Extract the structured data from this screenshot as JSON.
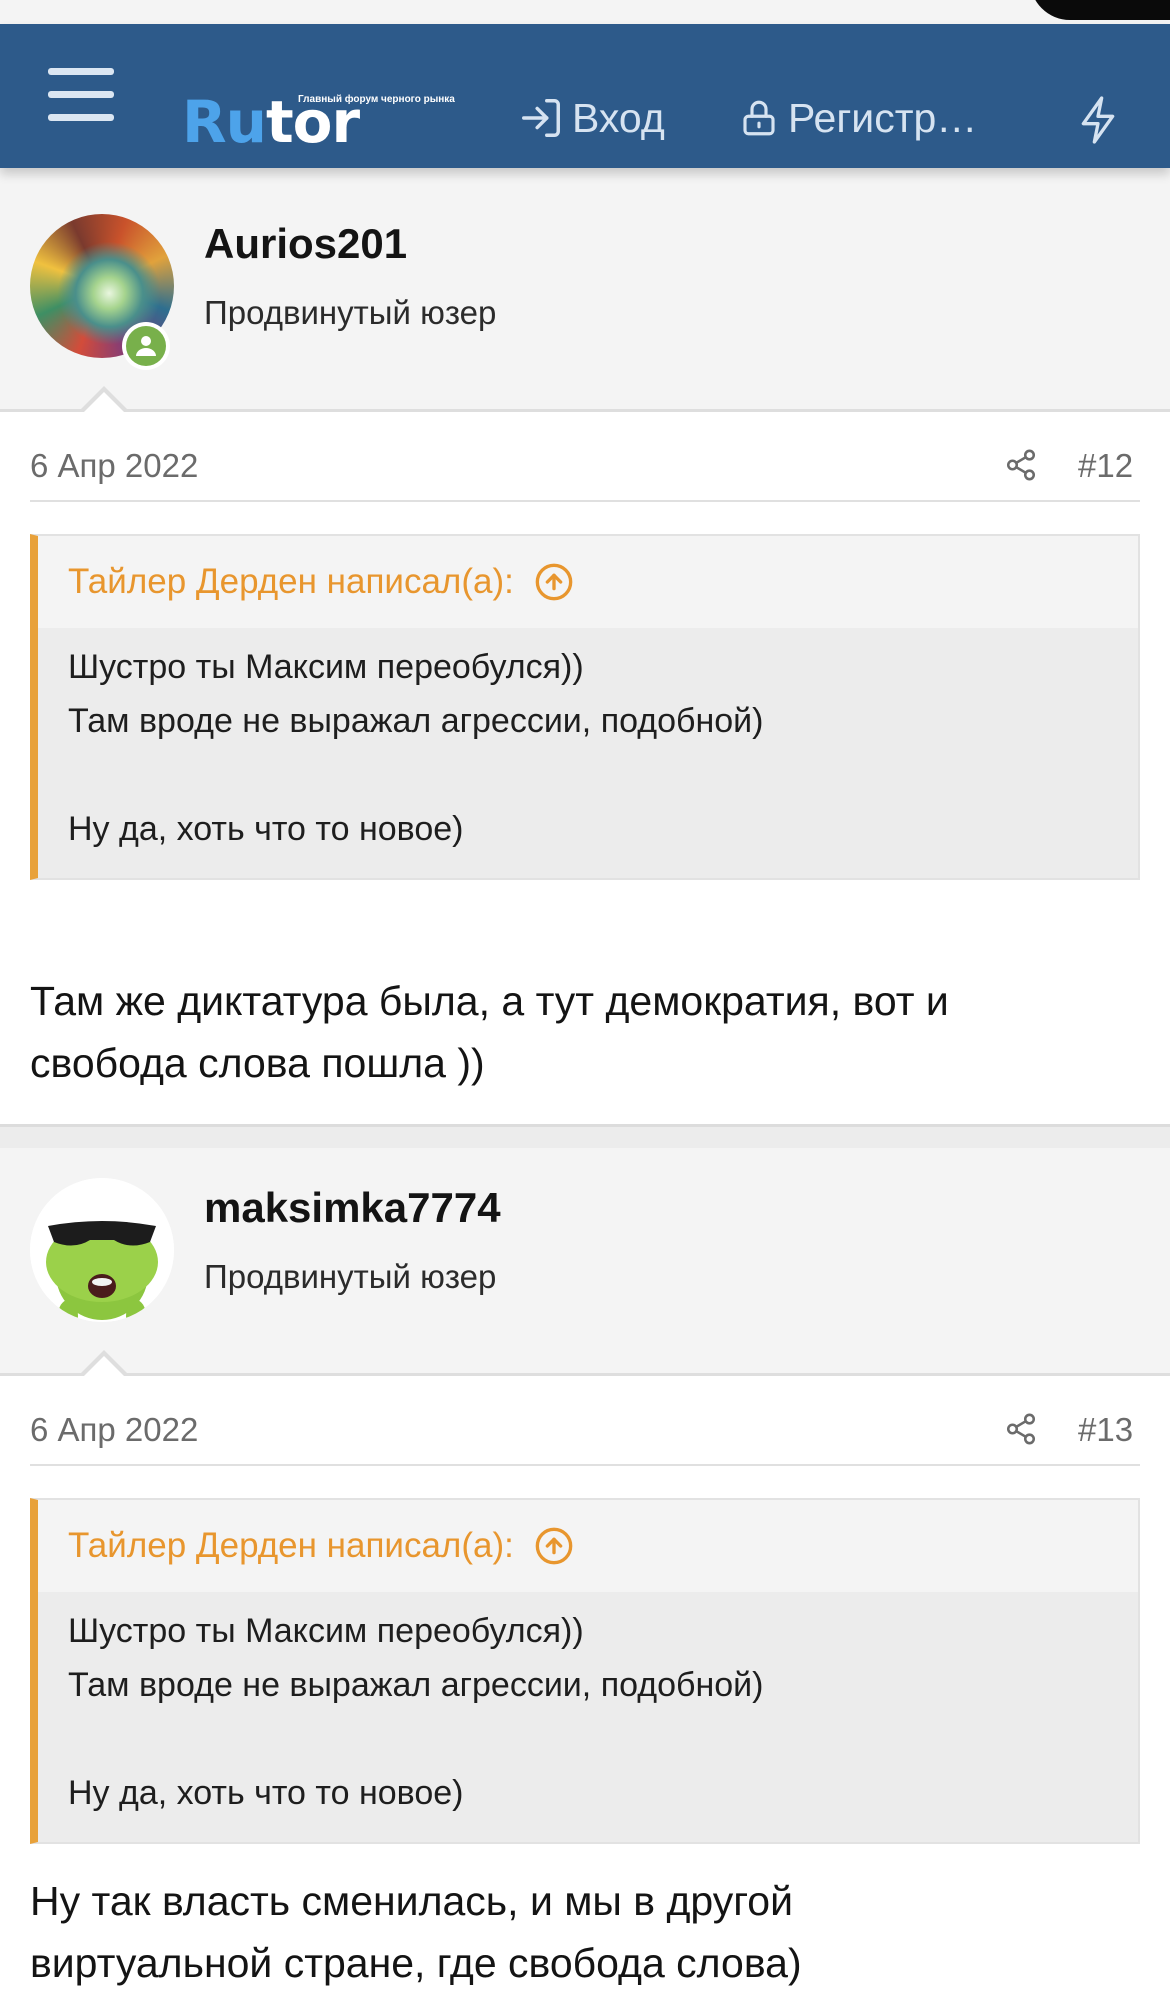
{
  "header": {
    "logo_main_a": "Ru",
    "logo_main_b": "tor",
    "logo_tagline": "Главный форум черного рынка",
    "login_label": "Вход",
    "register_label": "Регистр…",
    "bg_color": "#2d5a8a"
  },
  "posts": [
    {
      "username": "Aurios201",
      "user_title": "Продвинутый юзер",
      "online": true,
      "date": "6 Апр 2022",
      "post_number": "#12",
      "quote": {
        "author": "Тайлер Дерден написал(а):",
        "lines": [
          "Шустро ты Максим переобулся))",
          "Там вроде не выражал агрессии, подобной)",
          "",
          "Ну да, хоть что то новое)"
        ]
      },
      "text_lines": [
        "Там же диктатура была, а тут демократия, вот и",
        "свобода слова пошла ))"
      ]
    },
    {
      "username": "maksimka7774",
      "user_title": "Продвинутый юзер",
      "online": false,
      "date": "6 Апр 2022",
      "post_number": "#13",
      "quote": {
        "author": "Тайлер Дерден написал(а):",
        "lines": [
          "Шустро ты Максим переобулся))",
          "Там вроде не выражал агрессии, подобной)",
          "",
          "Ну да, хоть что то новое)"
        ]
      },
      "text_lines": [
        "Ну так власть сменилась, и мы в другой",
        "виртуальной стране, где свобода слова)"
      ]
    }
  ],
  "icons": {
    "menu": "hamburger-menu-icon",
    "login": "sign-in-icon",
    "register": "lock-open-icon",
    "whats_new": "bolt-icon",
    "share": "share-icon",
    "quote_jump": "arrow-up-circle-icon",
    "online": "online-status-icon"
  },
  "colors": {
    "quote_accent": "#e8a13a",
    "online_green": "#78b04b",
    "logo_blue": "#4da3ea"
  }
}
